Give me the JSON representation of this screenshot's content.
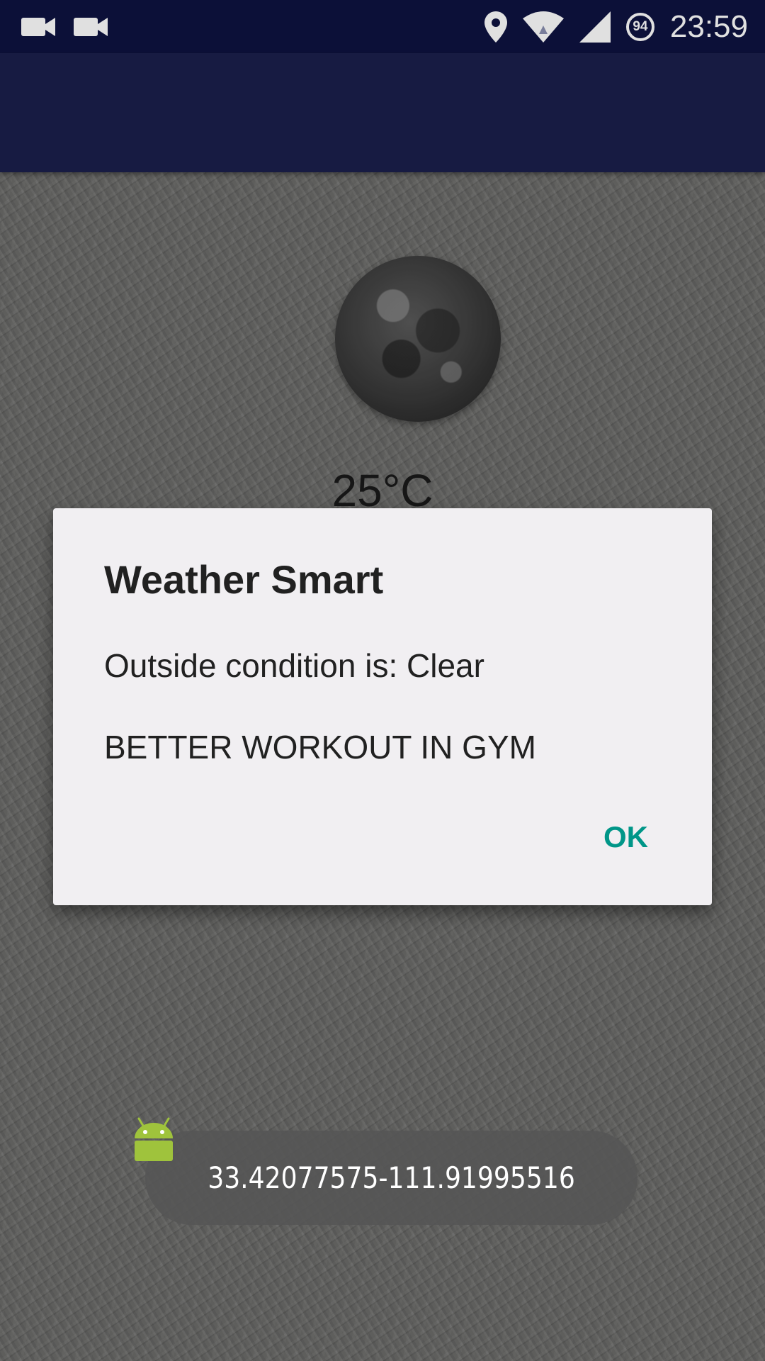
{
  "status_bar": {
    "time": "23:59",
    "battery_level": "94",
    "icons": [
      "video-camera-icon",
      "video-camera-icon",
      "location-pin-icon",
      "wifi-icon",
      "cell-signal-icon",
      "battery-saver-icon"
    ]
  },
  "main": {
    "weather_icon": "moon-icon",
    "temperature": "25°C"
  },
  "dialog": {
    "title": "Weather Smart",
    "condition_line": "Outside condition is: Clear",
    "advice_line": "BETTER WORKOUT IN GYM",
    "ok_label": "OK"
  },
  "toast": {
    "text": "33.42077575-111.91995516",
    "icon": "android-icon"
  },
  "colors": {
    "status_bar": "#0e1340",
    "app_bar": "#1b1f4c",
    "dialog_bg": "#f1eff2",
    "accent": "#009688",
    "android_green": "#9fc33c"
  }
}
